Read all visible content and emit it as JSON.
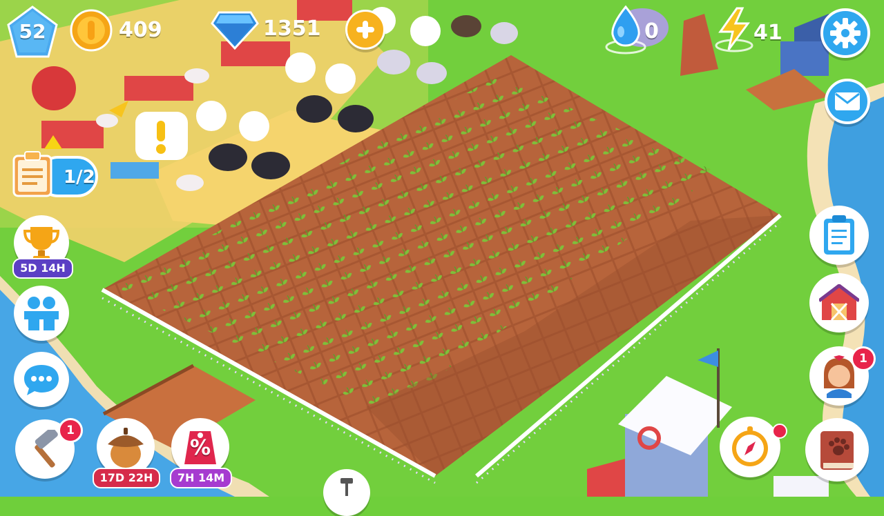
{
  "top_bar": {
    "level": "52",
    "coins": "409",
    "gems": "1351",
    "water": "0",
    "energy": "41"
  },
  "left_panel": {
    "task_progress": "1/2",
    "trophy_timer": "5D 14H"
  },
  "bottom_bar": {
    "build_badge": "1",
    "acorn_timer": "17D 22H",
    "sale_symbol": "%",
    "sale_timer": "7H 14M"
  },
  "right_panel": {
    "character_badge": "1"
  },
  "icons": [
    "level-gem-icon",
    "coin-icon",
    "gem-icon",
    "plus-icon",
    "water-drop-icon",
    "lightning-icon",
    "gear-icon",
    "mail-icon",
    "clipboard-icon",
    "barn-icon",
    "character-icon",
    "compass-icon",
    "paw-book-icon",
    "trophy-icon",
    "friends-icon",
    "chat-icon",
    "hammer-icon",
    "acorn-icon",
    "sale-tag-icon"
  ],
  "colors": {
    "grass": "#6fcf3b",
    "soil": "#b4613a",
    "water": "#3f9fe0",
    "accent_blue": "#2fa7ef",
    "badge_red": "#e8244a",
    "gold": "#f7b21e"
  }
}
